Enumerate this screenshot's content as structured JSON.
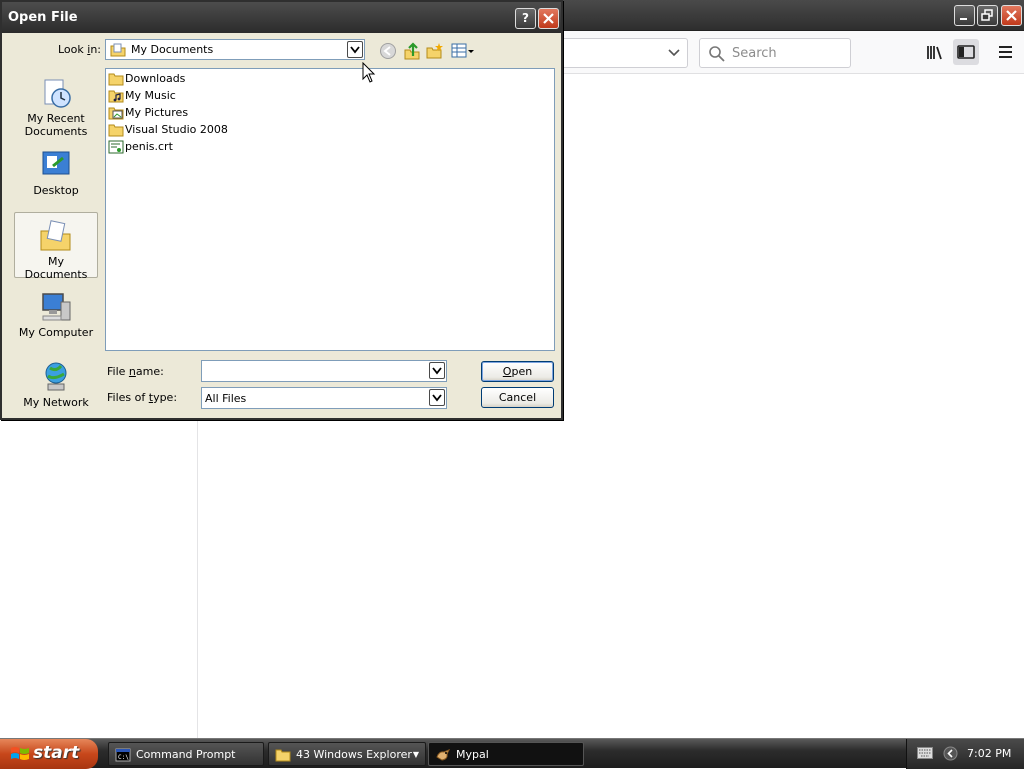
{
  "browser": {
    "search": {
      "placeholder": "Search"
    }
  },
  "dialog": {
    "title": "Open File",
    "look_in": {
      "label_pre": "Look ",
      "label_u": "i",
      "label_post": "n:",
      "value": "My Documents"
    },
    "places": [
      {
        "label": "My Recent Documents",
        "icon": "recent-documents-icon"
      },
      {
        "label": "Desktop",
        "icon": "desktop-icon"
      },
      {
        "label": "My Documents",
        "icon": "my-documents-icon"
      },
      {
        "label": "My Computer",
        "icon": "my-computer-icon"
      },
      {
        "label": "My Network",
        "icon": "my-network-icon"
      }
    ],
    "files": [
      {
        "name": "Downloads",
        "icon": "folder-icon"
      },
      {
        "name": "My Music",
        "icon": "music-folder-icon"
      },
      {
        "name": "My Pictures",
        "icon": "pictures-folder-icon"
      },
      {
        "name": "Visual Studio 2008",
        "icon": "folder-icon"
      },
      {
        "name": "penis.crt",
        "icon": "certificate-file-icon"
      }
    ],
    "file_name": {
      "label_pre": "File ",
      "label_u": "n",
      "label_post": "ame:",
      "value": ""
    },
    "file_type": {
      "label_pre": "Files of ",
      "label_u": "t",
      "label_post": "ype:",
      "value": "All Files"
    },
    "open_button": {
      "u": "O",
      "rest": "pen"
    },
    "cancel_button": "Cancel"
  },
  "taskbar": {
    "start": "start",
    "tasks": [
      {
        "label": "Command Prompt",
        "icon": "command-prompt-icon"
      },
      {
        "label": "43 Windows Explorer",
        "icon": "folder-icon"
      },
      {
        "label": "Mypal",
        "icon": "mypal-icon"
      }
    ],
    "clock": "7:02 PM"
  },
  "colors": {
    "dialog_bg": "#ece9d8",
    "titlebar": "#2b2b2b",
    "close_red": "#c0391b",
    "start_orange": "#c7471b"
  }
}
